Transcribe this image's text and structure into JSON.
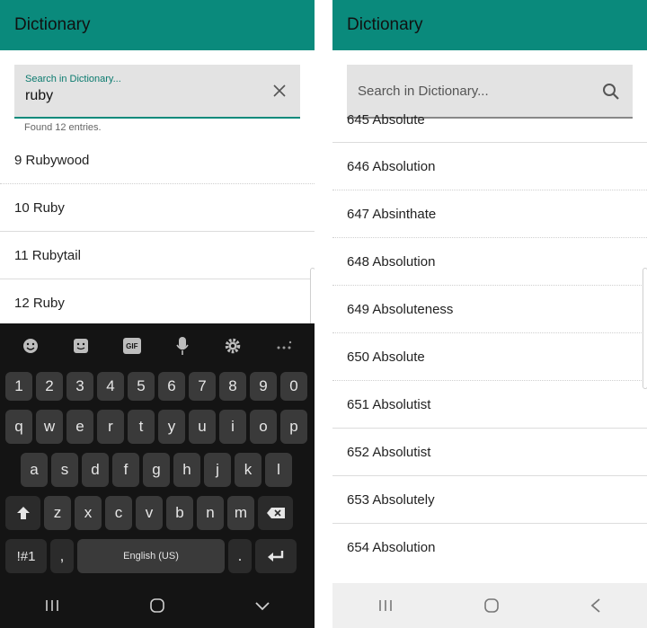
{
  "left": {
    "title": "Dictionary",
    "search": {
      "label": "Search in Dictionary...",
      "value": "ruby"
    },
    "found_text": "Found 12 entries.",
    "entries": [
      "9 Rubywood",
      "10 Ruby",
      "11 Rubytail",
      "12 Ruby"
    ],
    "keyboard": {
      "tool_icons": [
        "emoji-icon",
        "sticker-icon",
        "gif-icon",
        "mic-icon",
        "gear-icon",
        "more-icon"
      ],
      "gif_label": "GIF",
      "row_numbers": [
        "1",
        "2",
        "3",
        "4",
        "5",
        "6",
        "7",
        "8",
        "9",
        "0"
      ],
      "row_q": [
        "q",
        "w",
        "e",
        "r",
        "t",
        "y",
        "u",
        "i",
        "o",
        "p"
      ],
      "row_a": [
        "a",
        "s",
        "d",
        "f",
        "g",
        "h",
        "j",
        "k",
        "l"
      ],
      "row_z": [
        "z",
        "x",
        "c",
        "v",
        "b",
        "n",
        "m"
      ],
      "sym_label": "!#1",
      "comma_label": ",",
      "space_label": "English (US)",
      "period_label": "."
    }
  },
  "right": {
    "title": "Dictionary",
    "search": {
      "placeholder": "Search in Dictionary..."
    },
    "entries": [
      "645 Absolute",
      "646 Absolution",
      "647 Absinthate",
      "648 Absolution",
      "649 Absoluteness",
      "650 Absolute",
      "651 Absolutist",
      "652 Absolutist",
      "653 Absolutely",
      "654 Absolution"
    ]
  },
  "colors": {
    "appbar": "#0a8a7c",
    "keyboard_bg": "#141414",
    "key": "#3a3a3a"
  }
}
